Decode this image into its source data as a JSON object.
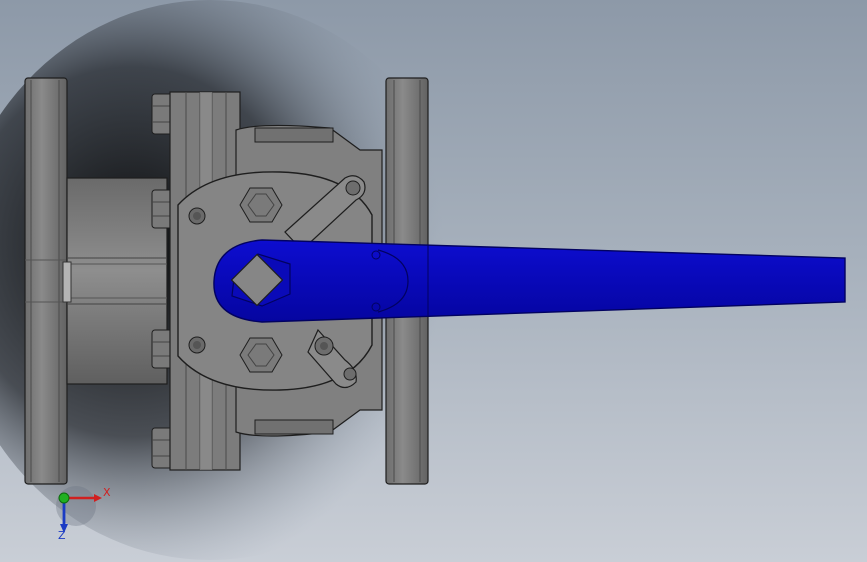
{
  "viewport": {
    "background_top": "#8d99a8",
    "background_bottom": "#c9ced6"
  },
  "model": {
    "part": "ball-valve-assembly",
    "body_color": "#7d7d7d",
    "handle_color": "#0b0bc0"
  },
  "triad": {
    "x_label": "X",
    "z_label": "Z",
    "x_color": "#d02020",
    "y_color": "#21b021",
    "z_color": "#1b3bc4"
  }
}
